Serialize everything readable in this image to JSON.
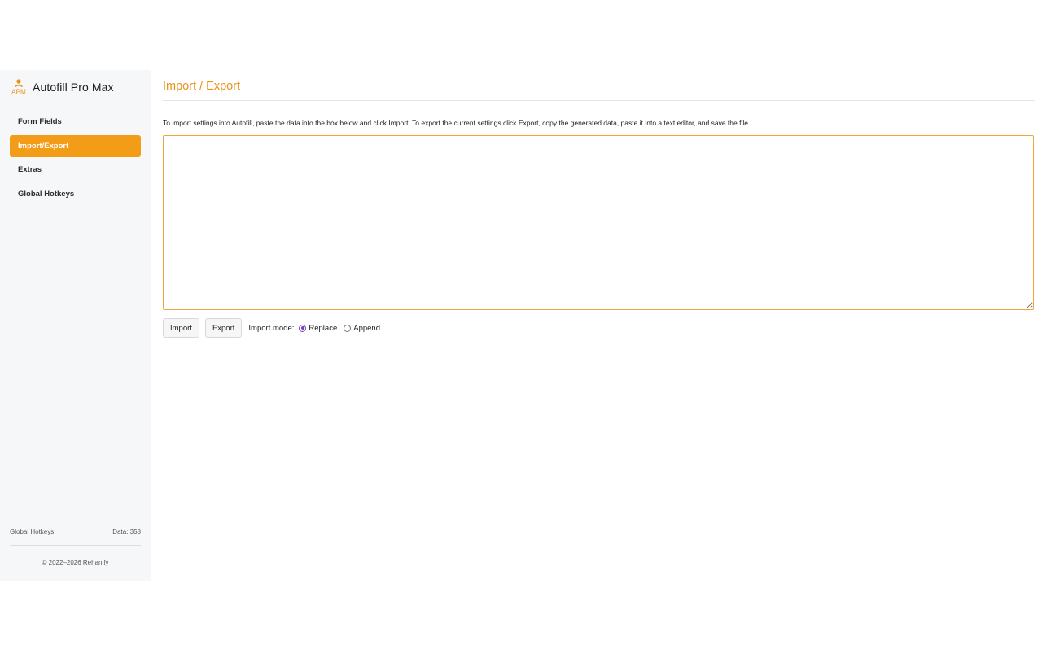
{
  "app": {
    "title": "Autofill Pro Max",
    "logo_text": "APM",
    "accent_color": "#f39c18"
  },
  "sidebar": {
    "items": [
      {
        "label": "Form Fields",
        "active": false
      },
      {
        "label": "Import/Export",
        "active": true
      },
      {
        "label": "Extras",
        "active": false
      },
      {
        "label": "Global Hotkeys",
        "active": false
      }
    ],
    "footer_left": "Global Hotkeys",
    "footer_right": "Data: 358",
    "copyright": "© 2022–2026 Rehanify"
  },
  "main": {
    "title": "Import / Export",
    "description": "To import settings into Autofill, paste the data into the box below and click Import. To export the current settings click Export, copy the generated data, paste it into a text editor, and save the file.",
    "data_value": "",
    "import_label": "Import",
    "export_label": "Export",
    "mode_label": "Import mode:",
    "mode_options": [
      {
        "label": "Replace",
        "checked": true
      },
      {
        "label": "Append",
        "checked": false
      }
    ]
  }
}
